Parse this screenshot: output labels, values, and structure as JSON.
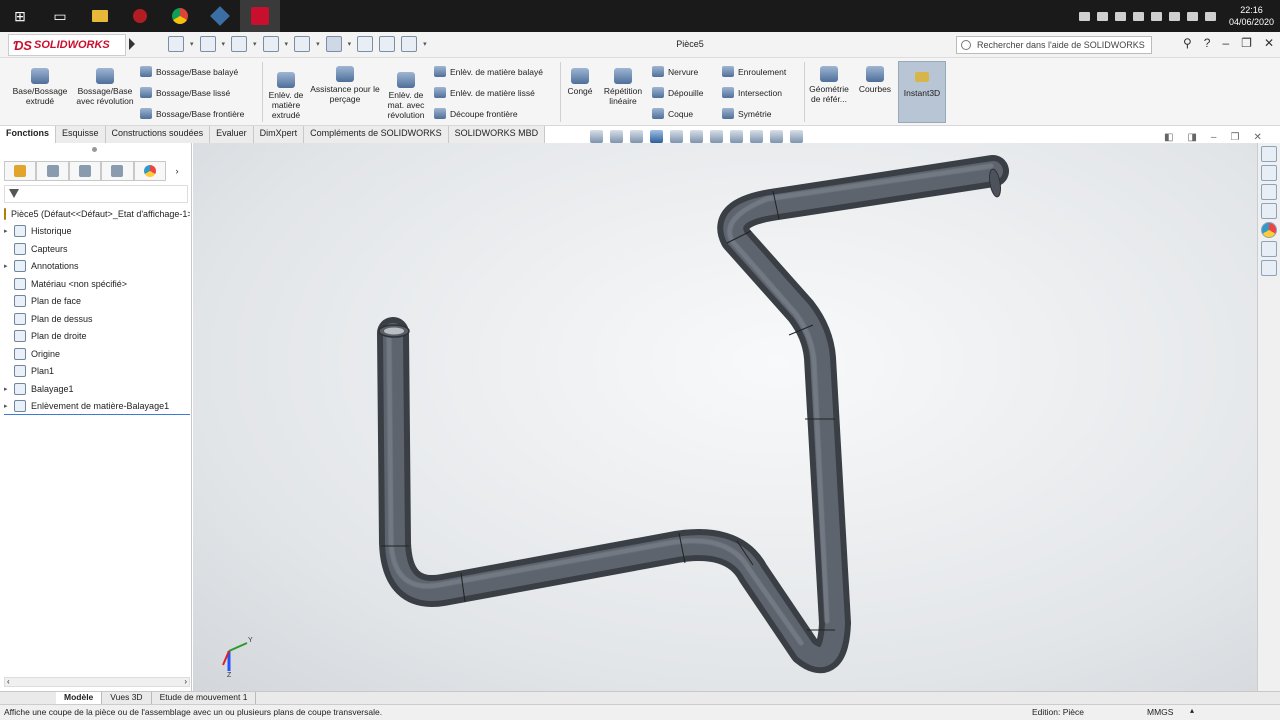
{
  "taskbar": {
    "icons": [
      "windows-start-icon",
      "task-view-icon",
      "file-explorer-icon",
      "red-app-icon",
      "chrome-icon",
      "pinned-app-icon",
      "solidworks-taskbar-icon"
    ],
    "clock": {
      "time": "22:16",
      "date": "04/06/2020"
    }
  },
  "titlebar": {
    "logo": "SOLIDWORKS",
    "doc_title": "Pièce5",
    "search_placeholder": "Rechercher dans l'aide de SOLIDWORKS"
  },
  "ribbon": {
    "extrude": "Base/Bossage extrudé",
    "revolve": "Bossage/Base avec révolution",
    "swept": "Bossage/Base balayé",
    "lofted": "Bossage/Base lissé",
    "boundary": "Bossage/Base frontière",
    "cut_extrude": "Enlèv. de matière extrudé",
    "hole_wizard": "Assistance pour le perçage",
    "cut_revolve": "Enlèv. de mat. avec révolution",
    "swept_cut": "Enlèv. de matière balayé",
    "lofted_cut": "Enlèv. de matière lissé",
    "boundary_cut": "Découpe frontière",
    "fillet": "Congé",
    "linear_pattern": "Répétition linéaire",
    "rib": "Nervure",
    "draft": "Dépouille",
    "shell": "Coque",
    "wrap": "Enroulement",
    "intersect": "Intersection",
    "mirror": "Symétrie",
    "ref_geometry": "Géométrie de référ...",
    "curves": "Courbes",
    "instant3d": "Instant3D"
  },
  "tabs": [
    "Fonctions",
    "Esquisse",
    "Constructions soudées",
    "Evaluer",
    "DimXpert",
    "Compléments de SOLIDWORKS",
    "SOLIDWORKS MBD"
  ],
  "tree": {
    "root": "Pièce5  (Défaut<<Défaut>_Etat d'affichage-1>)",
    "items": [
      {
        "label": "Historique",
        "expand": "▸"
      },
      {
        "label": "Capteurs",
        "expand": ""
      },
      {
        "label": "Annotations",
        "expand": "▸"
      },
      {
        "label": "Matériau <non spécifié>",
        "expand": ""
      },
      {
        "label": "Plan de face",
        "expand": ""
      },
      {
        "label": "Plan de dessus",
        "expand": ""
      },
      {
        "label": "Plan de droite",
        "expand": ""
      },
      {
        "label": "Origine",
        "expand": ""
      },
      {
        "label": "Plan1",
        "expand": ""
      },
      {
        "label": "Balayage1",
        "expand": "▸"
      },
      {
        "label": "Enlèvement de matière-Balayage1",
        "expand": "▸"
      }
    ]
  },
  "triad": {
    "x": "X",
    "y": "Y",
    "z": "Z"
  },
  "bottom_tabs": [
    "Modèle",
    "Vues 3D",
    "Etude de mouvement 1"
  ],
  "status": {
    "message": "Affiche une coupe de la pièce ou de l'assemblage avec un ou plusieurs plans de coupe transversale.",
    "edit_mode": "Edition: Pièce",
    "units": "MMGS"
  },
  "colors": {
    "tube": "#4a4f57",
    "tube_highlight": "#7c838d",
    "logo_red": "#c8102e",
    "instant3d_bg": "#b8c5d4"
  }
}
